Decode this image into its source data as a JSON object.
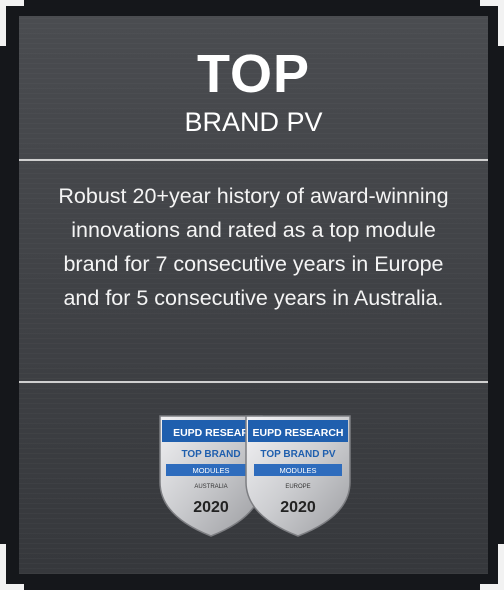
{
  "card": {
    "title": "TOP",
    "subtitle": "BRAND PV",
    "description_lines": [
      "Robust 20+year history of award-winning",
      "innovations and rated as a top module",
      "brand for 7 consecutive years in Europe",
      "and for 5 consecutive years in Australia."
    ]
  },
  "badges": [
    {
      "header": "EUPD RESEAR",
      "line1": "TOP BRAND",
      "line2": "MODULES",
      "region": "AUSTRALIA",
      "year": "2020"
    },
    {
      "header": "EUPD RESEARCH",
      "line1": "TOP BRAND PV",
      "line2": "MODULES",
      "region": "EUROPE",
      "year": "2020"
    }
  ],
  "colors": {
    "background": "#15171b",
    "card": "#45474b",
    "badge_blue": "#1f5fae",
    "badge_silver": "#d9dadd",
    "text": "#ffffff"
  }
}
